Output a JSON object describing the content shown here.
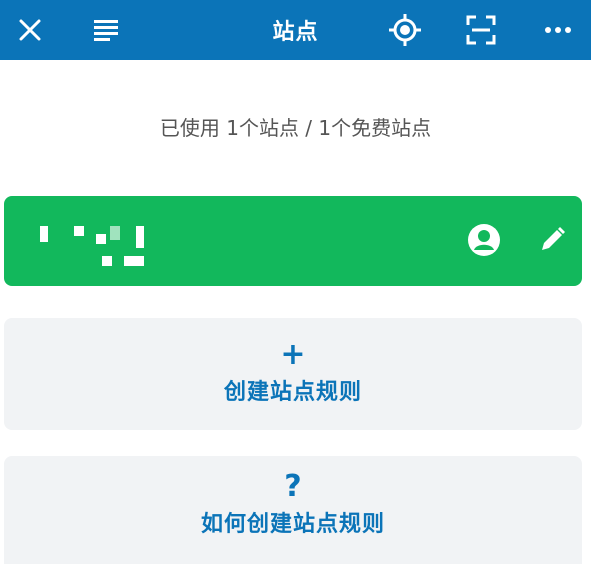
{
  "appbar": {
    "title": "站点",
    "icons": [
      "close-icon",
      "menu-icon",
      "locate-icon",
      "scan-icon",
      "more-icon"
    ]
  },
  "usage": {
    "text": "已使用 1个站点 / 1个免费站点"
  },
  "site_card": {
    "actions": [
      "user-icon",
      "edit-icon"
    ]
  },
  "cards": {
    "create": {
      "glyph": "+",
      "label": "创建站点规则"
    },
    "help": {
      "glyph": "?",
      "label": "如何创建站点规则"
    }
  },
  "colors": {
    "primary": "#0b74b8",
    "success": "#12b85c",
    "card_bg": "#f1f3f5",
    "muted_text": "#555555"
  }
}
